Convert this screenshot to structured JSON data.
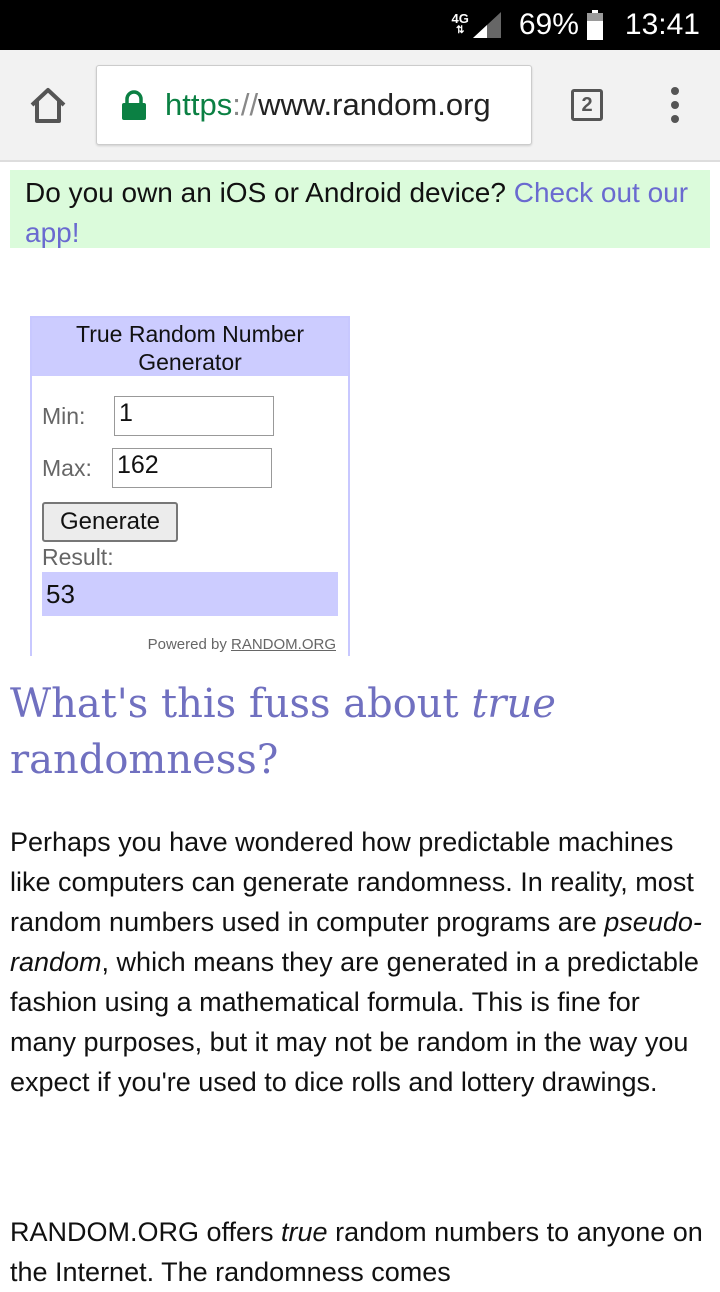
{
  "status_bar": {
    "network": "4G",
    "battery_percent": "69%",
    "time": "13:41",
    "icons": [
      "data-arrows-icon",
      "signal-icon",
      "battery-icon"
    ]
  },
  "browser": {
    "url_scheme": "https",
    "url_separator": "://",
    "url_host": "www.random.org",
    "tab_count": "2",
    "icons": [
      "home-icon",
      "lock-icon",
      "tab-switcher-icon",
      "overflow-menu-icon"
    ],
    "secure_color": "#0b8043"
  },
  "banner": {
    "text": "Do you own an iOS or Android device? ",
    "link_text": "Check out our app!",
    "background": "#dbfbdb",
    "link_color": "#6a6ad0"
  },
  "widget": {
    "title": "True Random Number Generator",
    "min_label": "Min:",
    "min_value": "1",
    "max_label": "Max:",
    "max_value": "162",
    "generate_label": "Generate",
    "result_label": "Result:",
    "result_value": "53",
    "powered_prefix": "Powered by ",
    "powered_link": "RANDOM.ORG",
    "accent": "#ccccff"
  },
  "article": {
    "heading_pre": "What's this fuss about ",
    "heading_em": "true",
    "heading_post": " randomness?",
    "p1_a": "Perhaps you have wondered how predictable machines like computers can generate randomness. In reality, most random numbers used in computer programs are ",
    "p1_em": "pseudo-random",
    "p1_b": ", which means they are generated in a predictable fashion using a mathematical formula. This is fine for many purposes, but it may not be random in the way you expect if you're used to dice rolls and lottery drawings.",
    "p2_a": "RANDOM.ORG offers ",
    "p2_em": "true",
    "p2_b": " random numbers to anyone on the Internet. The randomness comes",
    "heading_color": "#7070c0"
  }
}
